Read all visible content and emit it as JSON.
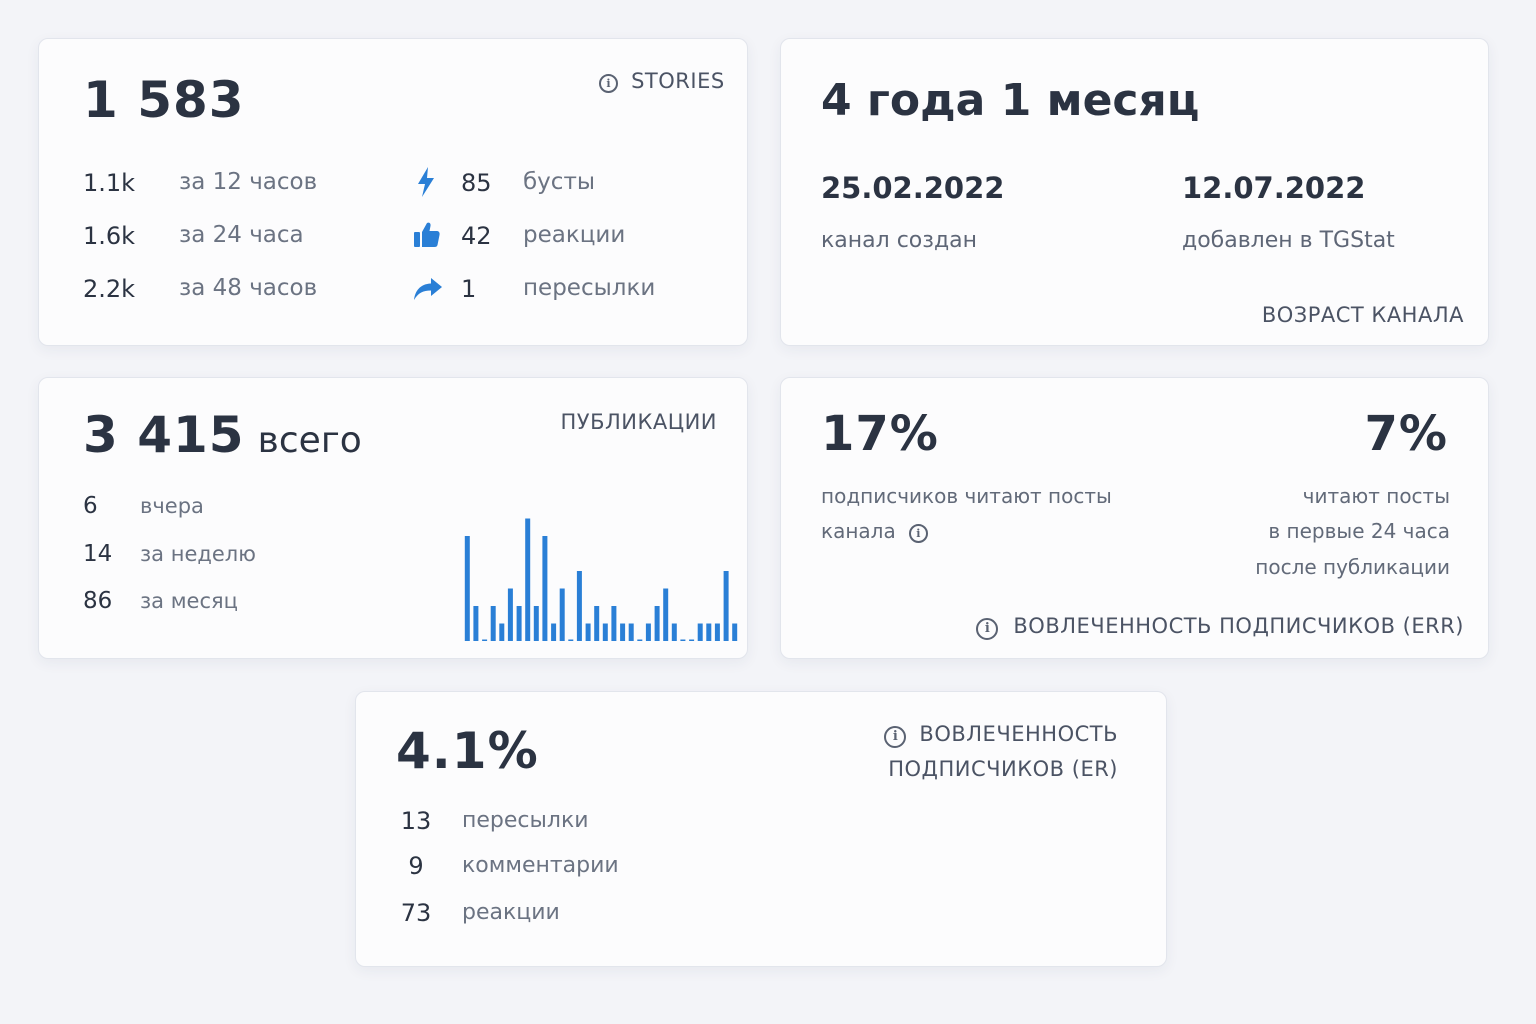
{
  "stories": {
    "total": "1 583",
    "title": "STORIES",
    "periods": [
      {
        "value": "1.1k",
        "label": "за 12 часов"
      },
      {
        "value": "1.6k",
        "label": "за 24 часа"
      },
      {
        "value": "2.2k",
        "label": "за 48 часов"
      }
    ],
    "stats": [
      {
        "icon": "lightning-icon",
        "value": "85",
        "label": "бусты"
      },
      {
        "icon": "thumbs-up-icon",
        "value": "42",
        "label": "реакции"
      },
      {
        "icon": "share-arrow-icon",
        "value": "1",
        "label": "пересылки"
      }
    ],
    "accent": "#2a7fd6"
  },
  "age": {
    "headline": "4 года 1 месяц",
    "created_date": "25.02.2022",
    "created_label": "канал создан",
    "added_date": "12.07.2022",
    "added_label": "добавлен в TGStat",
    "title": "ВОЗРАСТ КАНАЛА"
  },
  "publications": {
    "total": "3 415",
    "total_suffix": "всего",
    "title": "ПУБЛИКАЦИИ",
    "periods": [
      {
        "value": "6",
        "label": "вчера"
      },
      {
        "value": "14",
        "label": "за неделю"
      },
      {
        "value": "86",
        "label": "за месяц"
      }
    ]
  },
  "err": {
    "left_value": "17%",
    "left_label_1": "подписчиков читают посты",
    "left_label_2": "канала",
    "right_value": "7%",
    "right_label_1": "читают посты",
    "right_label_2": "в первые 24 часа",
    "right_label_3": "после публикации",
    "title": "ВОВЛЕЧЕННОСТЬ ПОДПИСЧИКОВ (ERR)"
  },
  "er": {
    "value": "4.1%",
    "title_1": "ВОВЛЕЧЕННОСТЬ",
    "title_2": "ПОДПИСЧИКОВ (ER)",
    "rows": [
      {
        "value": "13",
        "label": "пересылки"
      },
      {
        "value": "9",
        "label": "комментарии"
      },
      {
        "value": "73",
        "label": "реакции"
      }
    ]
  },
  "chart_data": {
    "type": "bar",
    "title": "",
    "xlabel": "",
    "ylabel": "",
    "ylim": [
      0,
      8
    ],
    "color": "#2a7fd6",
    "values": [
      6,
      2,
      0,
      2,
      1,
      3,
      2,
      7,
      2,
      6,
      1,
      3,
      0,
      4,
      1,
      2,
      1,
      2,
      1,
      1,
      0,
      1,
      2,
      3,
      1,
      0,
      0,
      1,
      1,
      1,
      4,
      1
    ]
  }
}
